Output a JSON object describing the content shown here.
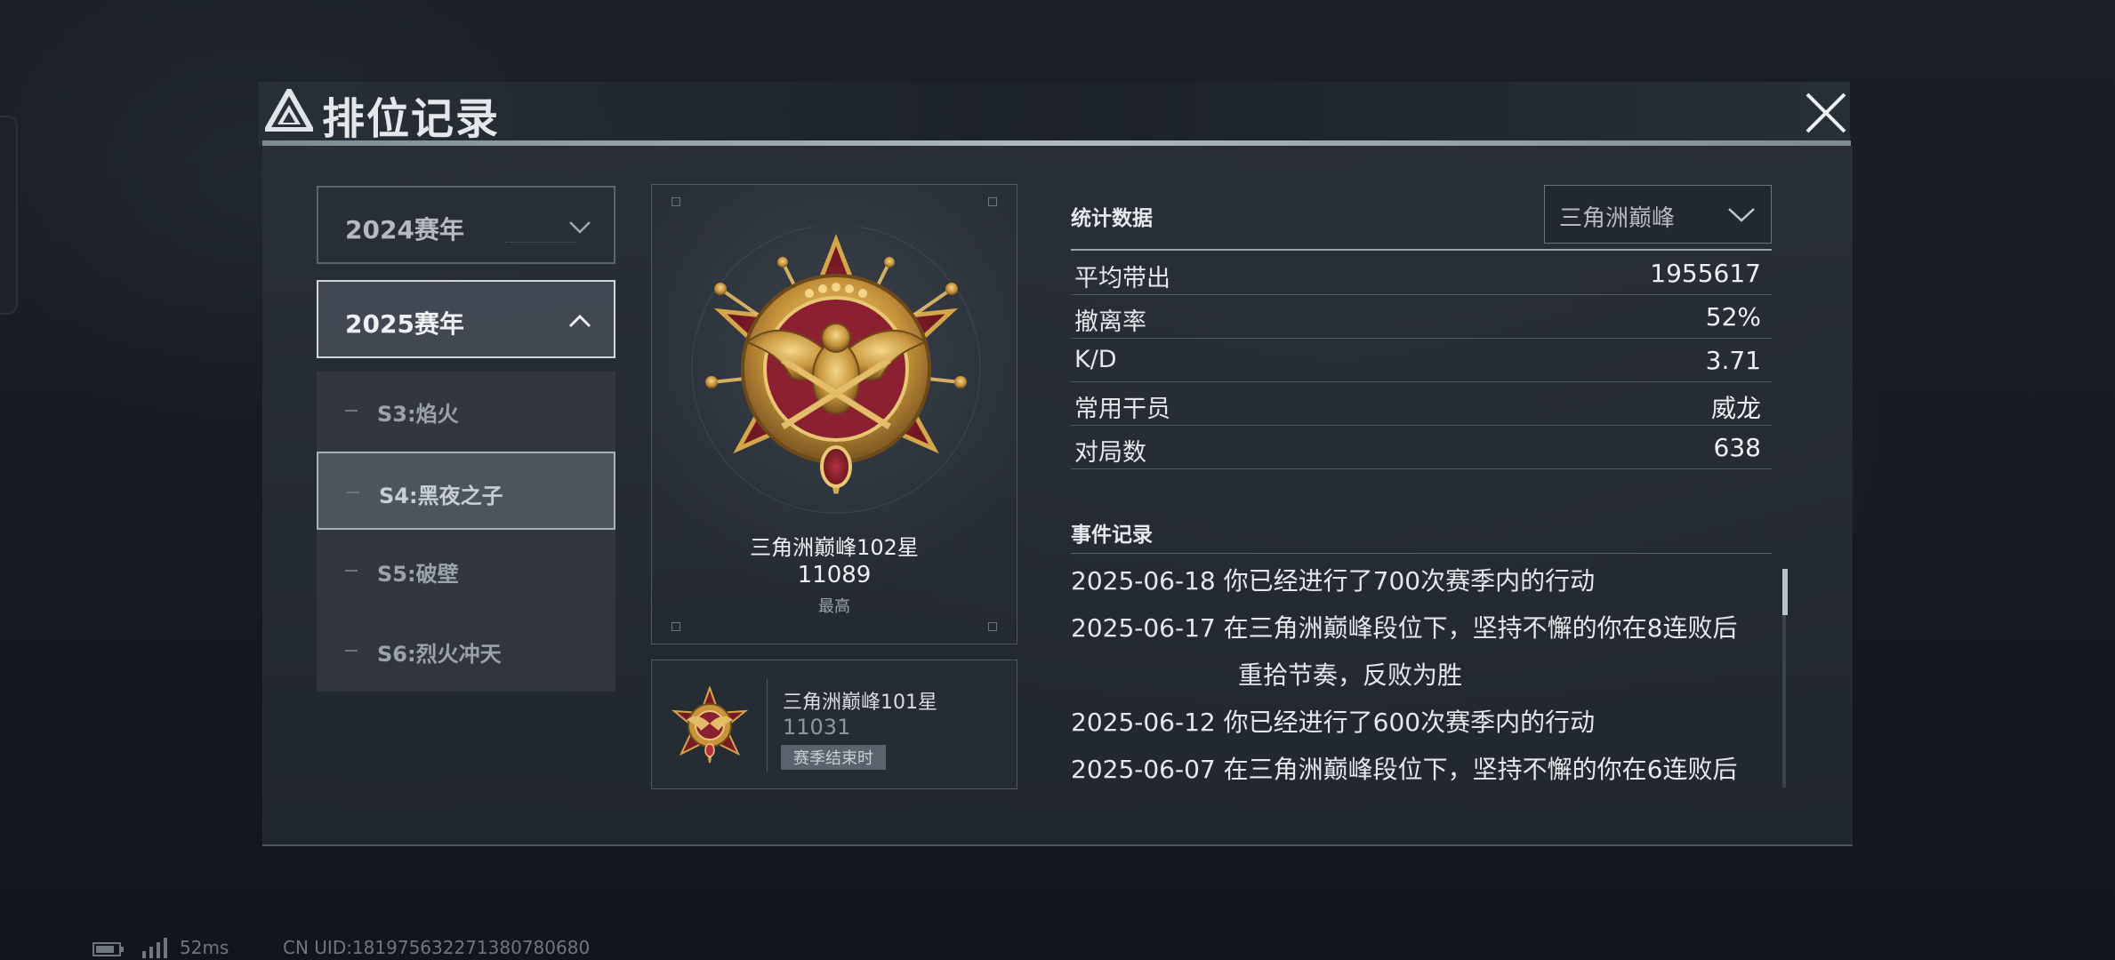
{
  "window": {
    "title": "排位记录"
  },
  "years": [
    {
      "label": "2024赛年",
      "expanded": false
    },
    {
      "label": "2025赛年",
      "expanded": true
    }
  ],
  "seasons": [
    {
      "label": "S3:焰火",
      "selected": false
    },
    {
      "label": "S4:黑夜之子",
      "selected": true
    },
    {
      "label": "S5:破壁",
      "selected": false
    },
    {
      "label": "S6:烈火冲天",
      "selected": false
    }
  ],
  "rank_card": {
    "name": "三角洲巅峰102星",
    "score": "11089",
    "tag": "最高",
    "medal_icon": "eagle-star-medal-icon"
  },
  "previous_rank": {
    "name": "三角洲巅峰101星",
    "score": "11031",
    "tag": "赛季结束时"
  },
  "stats": {
    "title": "统计数据",
    "mode_select": "三角洲巅峰",
    "rows": [
      {
        "label": "平均带出",
        "value": "1955617"
      },
      {
        "label": "撤离率",
        "value": "52%"
      },
      {
        "label": "K/D",
        "value": "3.71"
      },
      {
        "label": "常用干员",
        "value": "威龙"
      },
      {
        "label": "对局数",
        "value": "638"
      }
    ]
  },
  "events": {
    "title": "事件记录",
    "items": [
      {
        "text": "2025-06-18 你已经进行了700次赛季内的行动"
      },
      {
        "text": "2025-06-17 在三角洲巅峰段位下，坚持不懈的你在8连败后"
      },
      {
        "text": "重拾节奏，反败为胜"
      },
      {
        "text": "2025-06-12 你已经进行了600次赛季内的行动"
      },
      {
        "text": "2025-06-07 在三角洲巅峰段位下，坚持不懈的你在6连败后"
      }
    ]
  },
  "footer": {
    "ping": "52ms",
    "uid": "CN UID:181975632271380780680"
  },
  "colors": {
    "panel": "#2a3038",
    "accent_line": "#c8d4dc",
    "medal_gold": "#d4a64a",
    "medal_red": "#8a1e2a"
  }
}
